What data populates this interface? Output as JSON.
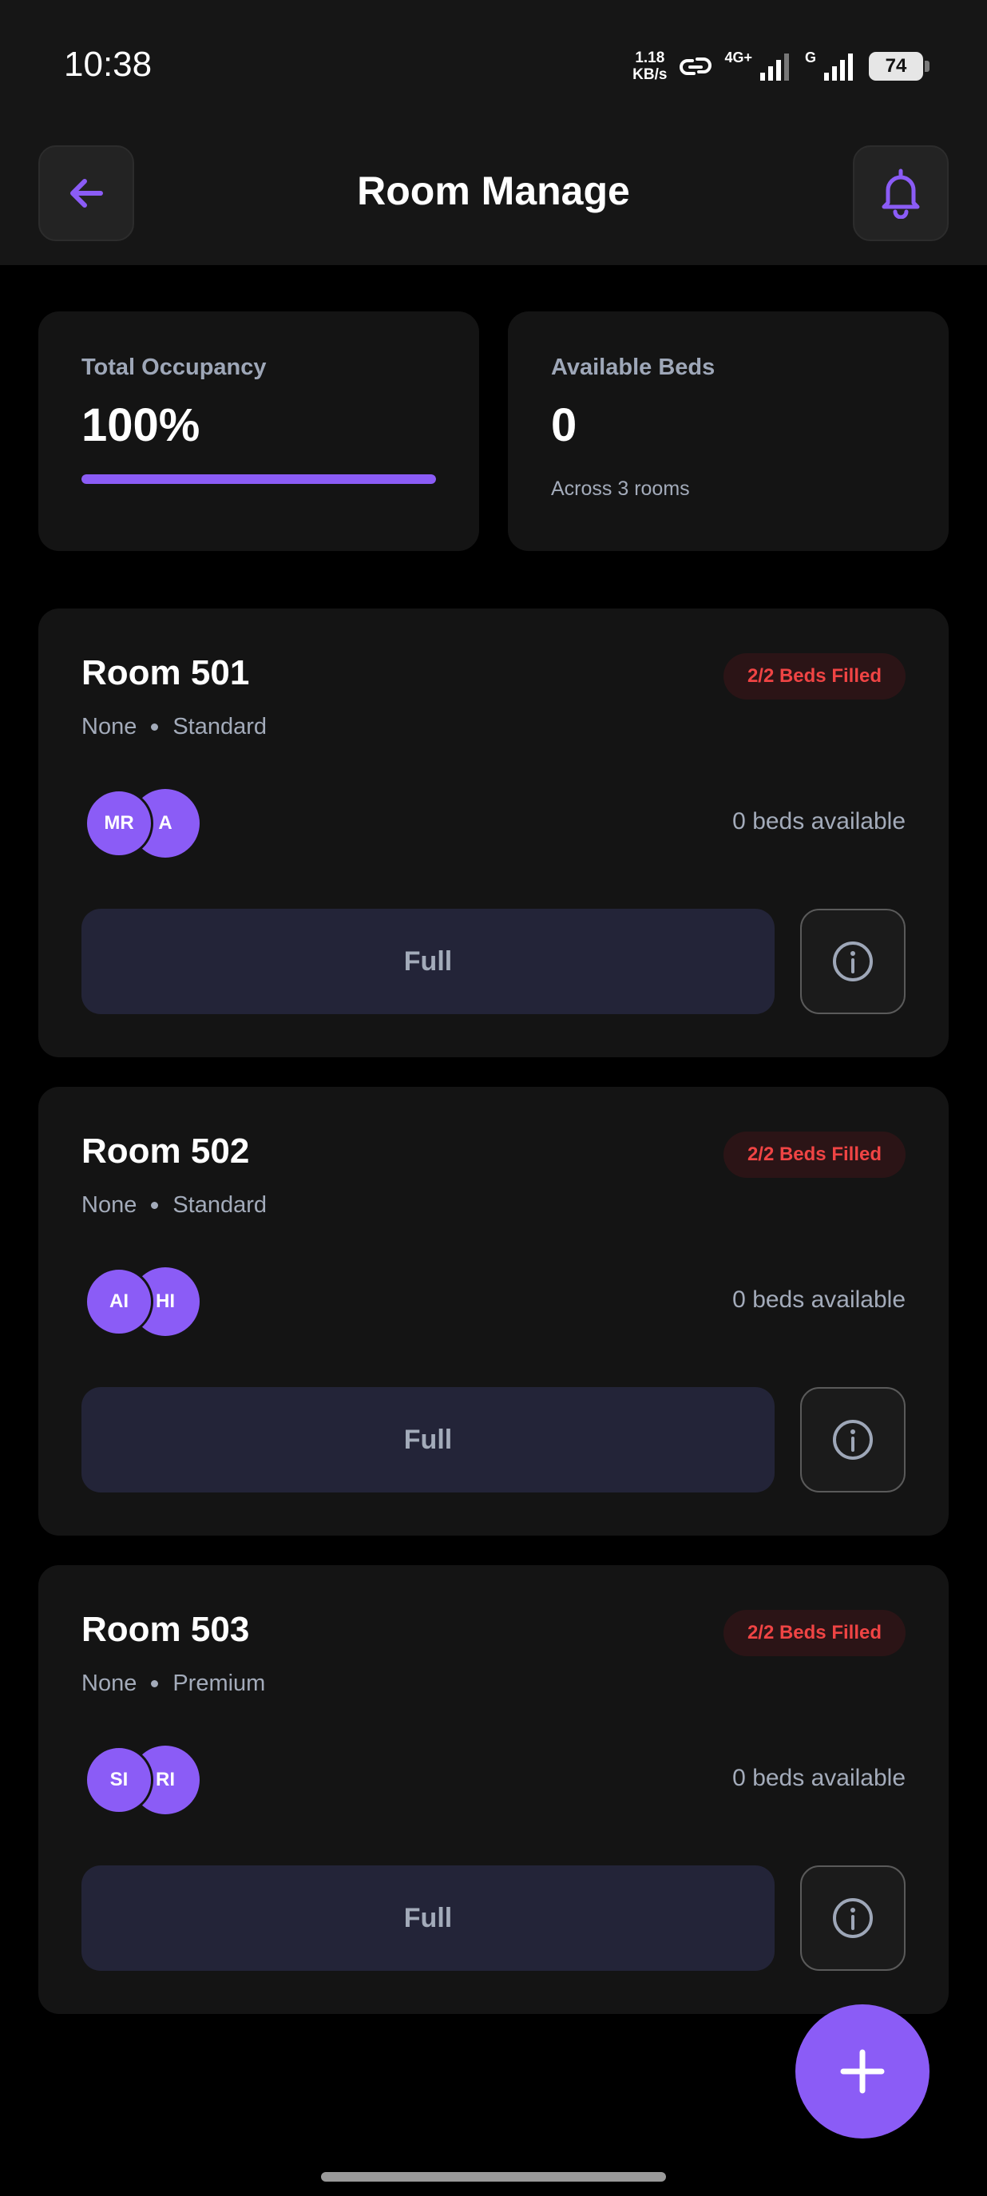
{
  "status_bar": {
    "time": "10:38",
    "net_speed_value": "1.18",
    "net_speed_unit": "KB/s",
    "network_1": "4G+",
    "network_2": "G",
    "battery": "74"
  },
  "header": {
    "title": "Room Manage",
    "back_icon": "arrow-left-icon",
    "bell_icon": "bell-icon"
  },
  "stats": {
    "occupancy": {
      "label": "Total Occupancy",
      "value": "100%",
      "progress_fraction": 1.0
    },
    "beds": {
      "label": "Available Beds",
      "value": "0",
      "subtitle": "Across 3 rooms"
    }
  },
  "rooms": [
    {
      "title": "Room 501",
      "floor": "None",
      "type": "Standard",
      "badge": "2/2 Beds Filled",
      "avatars": [
        "MR",
        "A"
      ],
      "beds_available": "0 beds available",
      "action_label": "Full"
    },
    {
      "title": "Room 502",
      "floor": "None",
      "type": "Standard",
      "badge": "2/2 Beds Filled",
      "avatars": [
        "AI",
        "HI"
      ],
      "beds_available": "0 beds available",
      "action_label": "Full"
    },
    {
      "title": "Room 503",
      "floor": "None",
      "type": "Premium",
      "badge": "2/2 Beds Filled",
      "avatars": [
        "SI",
        "RI"
      ],
      "beds_available": "0 beds available",
      "action_label": "Full"
    }
  ],
  "colors": {
    "accent": "#8b5cf6",
    "badge_text": "#ef4444",
    "badge_bg": "#2b1416",
    "card_bg": "#141414",
    "background": "#000000"
  },
  "fab_icon": "plus-icon"
}
